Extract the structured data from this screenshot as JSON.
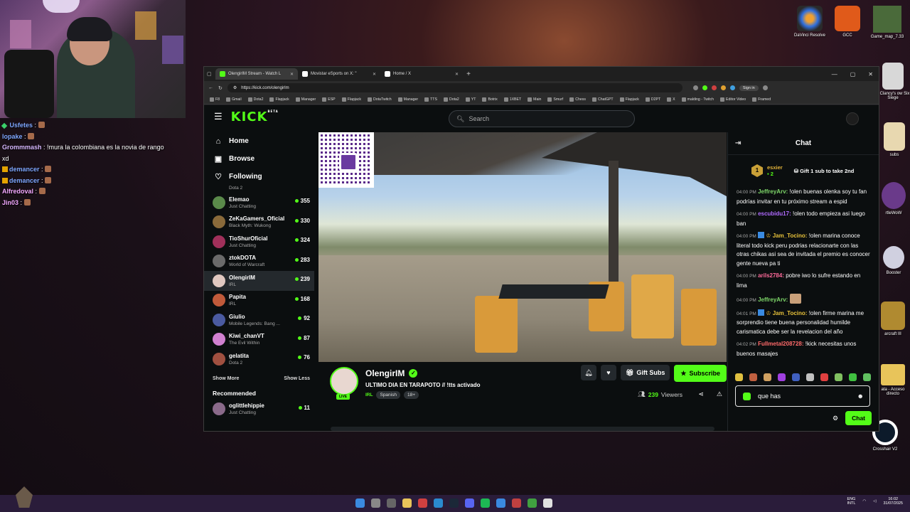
{
  "overlay_chat": [
    {
      "user": "Usfetes",
      "text": ":",
      "badge": "diamond"
    },
    {
      "user": "lopake",
      "text": ":",
      "badge": ""
    },
    {
      "user": "Grommmash",
      "text": ": !mura la colombiana es la novia de rango xd",
      "badge": ""
    },
    {
      "user": "demancer",
      "text": ":",
      "badge": "crown"
    },
    {
      "user": "demancer",
      "text": ":",
      "badge": "crown"
    },
    {
      "user": "Alfredoval",
      "text": ":",
      "badge": ""
    },
    {
      "user": "Jin03",
      "text": ":",
      "badge": ""
    }
  ],
  "desktop_icons": [
    {
      "label": "DaVinci Resolve",
      "icon": "davinci-icon"
    },
    {
      "label": "GCC",
      "icon": "gcc-icon"
    },
    {
      "label": "Game_map_7.33",
      "icon": "map-icon"
    },
    {
      "label": "n Clancy's ow Six Siege",
      "icon": "siege-icon"
    },
    {
      "label": "subs",
      "icon": "subs-icon"
    },
    {
      "label": "rtleWoW",
      "icon": "wow-icon"
    },
    {
      "label": "Booster",
      "icon": "booster-icon"
    },
    {
      "label": "arcraft III",
      "icon": "warcraft-icon"
    },
    {
      "label": "ata - Acceso directo",
      "icon": "folder-icon"
    },
    {
      "label": "Crosshair V2",
      "icon": "crosshair-icon"
    }
  ],
  "browser": {
    "tabs": [
      {
        "title": "OlengirIM Stream - Watch L",
        "active": true,
        "color": "#53fc18"
      },
      {
        "title": "Movistar eSports on X: \"",
        "active": false,
        "color": "#ffffff"
      },
      {
        "title": "Home / X",
        "active": false,
        "color": "#ffffff"
      }
    ],
    "url": "https://kick.com/olengirlm",
    "signin": "Sign in",
    "bookmarks": [
      "F8",
      "Gmail",
      "Dota2",
      "Flapjack",
      "Manager",
      "ESP",
      "Flapjack",
      "DotaTwitch",
      "Manager",
      "TTS",
      "Dota2",
      "YT",
      "Botrix",
      "1XBET",
      "Main",
      "Smurf",
      "Chess",
      "ChatGPT",
      "Flapjack",
      "D2PT",
      "X",
      "malding - Twitch",
      "Editor Video",
      "Framed"
    ]
  },
  "kick": {
    "logo": "KICK",
    "logo_sup": "BETA",
    "search_placeholder": "Search",
    "nav": [
      {
        "label": "Home",
        "icon": "home-icon"
      },
      {
        "label": "Browse",
        "icon": "browse-icon"
      },
      {
        "label": "Following",
        "icon": "heart-icon"
      }
    ],
    "partial_category": "Dota 2",
    "following": [
      {
        "name": "Elemao",
        "category": "Just Chatting",
        "viewers": "355",
        "color": "#5a8a4a"
      },
      {
        "name": "ZeKaGamers_Oficial",
        "category": "Black Myth: Wukong",
        "viewers": "330",
        "color": "#8a6a3a"
      },
      {
        "name": "TioShurOficial",
        "category": "Just Chatting",
        "viewers": "324",
        "color": "#a0305a"
      },
      {
        "name": "ztokDOTA",
        "category": "World of Warcraft",
        "viewers": "283",
        "color": "#6a6a6a"
      },
      {
        "name": "OlengirIM",
        "category": "IRL",
        "viewers": "239",
        "color": "#e0c8c0",
        "selected": true
      },
      {
        "name": "Papita",
        "category": "IRL",
        "viewers": "168",
        "color": "#c05a3a"
      },
      {
        "name": "Giulio",
        "category": "Mobile Legends: Bang ...",
        "viewers": "92",
        "color": "#4a5aa0"
      },
      {
        "name": "Kiwi_chanVT",
        "category": "The Evil Within",
        "viewers": "87",
        "color": "#d080d0"
      },
      {
        "name": "gelatita",
        "category": "Dota 2",
        "viewers": "76",
        "color": "#a05040"
      }
    ],
    "show_more": "Show More",
    "show_less": "Show Less",
    "recommended_label": "Recommended",
    "recommended": [
      {
        "name": "oglittlehippie",
        "category": "Just Chatting",
        "viewers": "11",
        "color": "#8a6a8a"
      }
    ],
    "channel": {
      "name": "OlengirIM",
      "live": "LIVE",
      "title": "ULTIMO DIA EN TARAPOTO // !tts activado",
      "category": "IRL",
      "tags": [
        "Spanish",
        "18+"
      ],
      "gift_subs": "Gift Subs",
      "subscribe": "Subscribe",
      "viewers": "239",
      "viewers_label": "Viewers"
    },
    "chat": {
      "title": "Chat",
      "pinned_user": "esxier",
      "pinned_rank": "1",
      "pinned_count": "2",
      "pinned_cta": "Gift 1 sub to take 2nd",
      "messages": [
        {
          "time": "04:00 PM",
          "user": "JeffreyArv:",
          "color": "#7fd86a",
          "text": "!olen buenas olenka soy tu fan podrías invitar en tu próximo stream a espid"
        },
        {
          "time": "04:00 PM",
          "user": "escubidu17:",
          "color": "#b06aff",
          "text": "!olen todo empieza asi luego ban"
        },
        {
          "time": "04:00 PM",
          "user": "Jam_Tocino:",
          "color": "#e8c23a",
          "text": "!olen marina conoce literal todo kick peru podrias relacionarte con las otras chikas asi sea de invitada el premio es conocer gente nueva pa ti"
        },
        {
          "time": "04:00 PM",
          "user": "arils2784:",
          "color": "#ff6a9a",
          "text": "pobre iwo lo sufre estando en lima"
        },
        {
          "time": "04:00 PM",
          "user": "JeffreyArv:",
          "color": "#7fd86a",
          "text": ""
        },
        {
          "time": "04:01 PM",
          "user": "Jam_Tocino:",
          "color": "#e8c23a",
          "text": "!olen firme marina me sorprendio tiene buena personalidad humilde carismatica debe ser la revelacion del año"
        },
        {
          "time": "04:02 PM",
          "user": "Fullmetal208728:",
          "color": "#ff6a6a",
          "text": "!kick necesitas unos buenos masajes"
        }
      ],
      "input_value": "que has",
      "send": "Chat"
    }
  },
  "taskbar": {
    "lang": "ENG",
    "layout": "INTL",
    "time": "16:02",
    "date": "31/07/2025"
  }
}
